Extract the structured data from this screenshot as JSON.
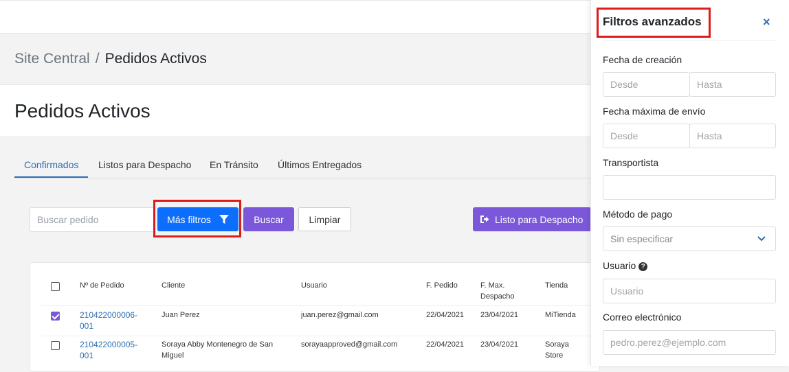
{
  "breadcrumb": {
    "parent": "Site Central",
    "separator": "/",
    "current": "Pedidos Activos"
  },
  "page": {
    "title": "Pedidos Activos"
  },
  "tabs": [
    {
      "label": "Confirmados",
      "active": true
    },
    {
      "label": "Listos para Despacho",
      "active": false
    },
    {
      "label": "En Tránsito",
      "active": false
    },
    {
      "label": "Últimos Entregados",
      "active": false
    }
  ],
  "toolbar": {
    "search_placeholder": "Buscar pedido",
    "more_filters_label": "Más filtros",
    "search_label": "Buscar",
    "clear_label": "Limpiar",
    "ready_dispatch_label": "Listo para Despacho"
  },
  "table": {
    "headers": {
      "order_no": "Nº de Pedido",
      "client": "Cliente",
      "user": "Usuario",
      "order_date": "F. Pedido",
      "max_dispatch_1": "F. Max.",
      "max_dispatch_2": "Despacho",
      "store": "Tienda"
    },
    "rows": [
      {
        "checked": true,
        "order_no_1": "210422000006-",
        "order_no_2": "001",
        "client_1": "Juan Perez",
        "client_2": "",
        "user": "juan.perez@gmail.com",
        "order_date": "22/04/2021",
        "max_dispatch": "23/04/2021",
        "store_1": "MiTienda",
        "store_2": ""
      },
      {
        "checked": false,
        "order_no_1": "210422000005-",
        "order_no_2": "001",
        "client_1": "Soraya Abby Montenegro de San",
        "client_2": "Miguel",
        "user": "sorayaapproved@gmail.com",
        "order_date": "22/04/2021",
        "max_dispatch": "23/04/2021",
        "store_1": "Soraya",
        "store_2": "Store"
      }
    ]
  },
  "filters_panel": {
    "title": "Filtros avanzados",
    "close_label": "×",
    "creation_date_label": "Fecha de creación",
    "max_ship_date_label": "Fecha máxima de envío",
    "from_placeholder": "Desde",
    "to_placeholder": "Hasta",
    "carrier_label": "Transportista",
    "payment_method_label": "Método de pago",
    "payment_method_value": "Sin especificar",
    "user_label": "Usuario",
    "user_placeholder": "Usuario",
    "email_label": "Correo electrónico",
    "email_placeholder": "pedro.perez@ejemplo.com"
  },
  "colors": {
    "primary": "#0d6efd",
    "purple": "#7b57d9",
    "link": "#2c6fb2",
    "highlight": "#dd1b1b"
  }
}
